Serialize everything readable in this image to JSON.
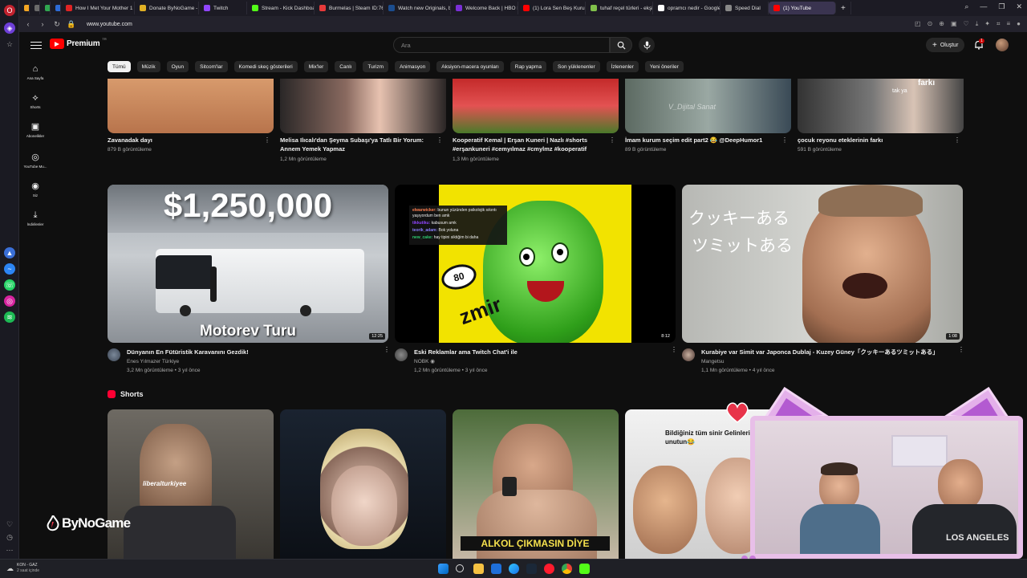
{
  "browser": {
    "tabs": [
      {
        "label": "",
        "color": "#f4a623"
      },
      {
        "label": "",
        "color": "#6a6a6a"
      },
      {
        "label": "",
        "color": "#30a650"
      },
      {
        "label": "",
        "color": "#2d6bd6"
      },
      {
        "label": "How I Met Your Mother 1",
        "color": "#e02424"
      },
      {
        "label": "Donate ByNoGame - Stre",
        "color": "#e0b024"
      },
      {
        "label": "Twitch",
        "color": "#9146ff"
      },
      {
        "label": "Stream - Kick Dashboard",
        "color": "#53fc18"
      },
      {
        "label": "Burmelas | Steam ID:7656",
        "color": "#e83a3a"
      },
      {
        "label": "Watch new Originals, blo",
        "color": "#1b4d8f"
      },
      {
        "label": "Welcome Back | HBO Max",
        "color": "#7a2fd6"
      },
      {
        "label": "(1) Lora Sen Beş Kuruş Et",
        "color": "#ff0000"
      },
      {
        "label": "tuhaf reçel türleri - ekşi sö",
        "color": "#81c14b"
      },
      {
        "label": "opramcı nedir - Google'd",
        "color": "#ffffff"
      },
      {
        "label": "Speed Dial",
        "color": "#888888"
      },
      {
        "label": "(1) YouTube",
        "color": "#ff0000",
        "active": true
      }
    ],
    "url": "www.youtube.com"
  },
  "youtube": {
    "logo_text": "Premium",
    "logo_tm": "TR",
    "search_placeholder": "Ara",
    "create_label": "Oluştur",
    "notif_count": "1",
    "guide": [
      {
        "label": "Ana Sayfa",
        "icon": "home-icon"
      },
      {
        "label": "Shorts",
        "icon": "shorts-icon"
      },
      {
        "label": "Abonelikler",
        "icon": "subscriptions-icon"
      },
      {
        "label": "YouTube Mu...",
        "icon": "youtube-music-icon"
      },
      {
        "label": "Siz",
        "icon": "you-icon"
      },
      {
        "label": "İndirilenler",
        "icon": "downloads-icon"
      }
    ],
    "chips": [
      "Tümü",
      "Müzik",
      "Oyun",
      "Sitcom'lar",
      "Komedi skeç gösterileri",
      "Mix'ler",
      "Canlı",
      "Turizm",
      "Animasyon",
      "Aksiyon-macera oyunları",
      "Rap yapma",
      "Son yüklenenler",
      "İzlenenler",
      "Yeni öneriler"
    ],
    "top_row": [
      {
        "title": "Zavanadak dayı",
        "title2": "",
        "meta": "879 B görüntüleme"
      },
      {
        "title": "Melisa Ilıcalı'dan Şeyma Subaşı'ya Tatlı Bir Yorum:",
        "title2": "Annem Yemek Yapmaz",
        "meta": "1,2 Mn görüntüleme"
      },
      {
        "title": "Kooperatif Kemal | Erşan Kuneri | Nazlı #shorts",
        "title2": "#erşankuneri #cemyılmaz #cmylmz #kooperatif",
        "meta": "1,3 Mn görüntüleme"
      },
      {
        "title": "İmam kurum seçim edit part2 😂 @DeepHumor1",
        "title2": "",
        "meta": "89 B görüntüleme"
      },
      {
        "title": "çocuk reyonu eteklerinin farkı",
        "title2": "",
        "meta": "591 B görüntüleme"
      }
    ],
    "videos": [
      {
        "title": "Dünyanın En Fütüristik Karavanını Gezdik!",
        "channel": "Enes Yılmazer Türkiye",
        "meta": "3,2 Mn görüntüleme • 3 yıl önce",
        "duration": "12:25",
        "thumb_big": "$1,250,000",
        "thumb_caption": "Motorev Turu"
      },
      {
        "title": "Eski Reklamlar ama Twitch Chat'i ile",
        "channel": "NOBK",
        "meta": "1,2 Mn görüntüleme • 3 yıl önce",
        "duration": "8:12",
        "chat": [
          {
            "user": "elwarwicker:",
            "msg": "bunun yüzünden psikolojik sıkıntı yaşıyordum ben amk",
            "color": "#ff7f50"
          },
          {
            "user": "tikkutiku:",
            "msg": "kabusum amk",
            "color": "#9146ff"
          },
          {
            "user": "teorik_adam:",
            "msg": "Bok yoluna",
            "color": "#8a7dff"
          },
          {
            "user": "new_cake:",
            "msg": "hay tipini siktiğim bi daha",
            "color": "#2ecc71"
          }
        ],
        "thumb_badge": "80",
        "thumb_word": "zmir"
      },
      {
        "title": "Kurabiye var Simit var Japonca Dublaj - Kuzey Güney「クッキーあるツミットある」",
        "channel": "Mangetsu",
        "meta": "1,1 Mn görüntüleme • 4 yıl önce",
        "duration": "1:08",
        "jp1": "クッキーある",
        "jp2": "ツミットある"
      }
    ],
    "shorts_label": "Shorts",
    "shorts": [
      {
        "overlay": "liberalturkiyee"
      },
      {
        "overlay": ""
      },
      {
        "overlay": "ALKOL ÇIKMASIN DİYE"
      },
      {
        "overlay": "Bildiğiniz tüm sinir Gelinleri unutun😂"
      }
    ],
    "top_thumb_texts": {
      "t5": "farkı",
      "t5b": "tak ya",
      "t4": "V_Dijital Sanat"
    }
  },
  "overlay": {
    "brand": "ByNoGame",
    "cam_text": "LOS ANGELES"
  },
  "taskbar": {
    "weather_title": "KON - GAZ",
    "weather_sub": "2 saat içinde"
  }
}
